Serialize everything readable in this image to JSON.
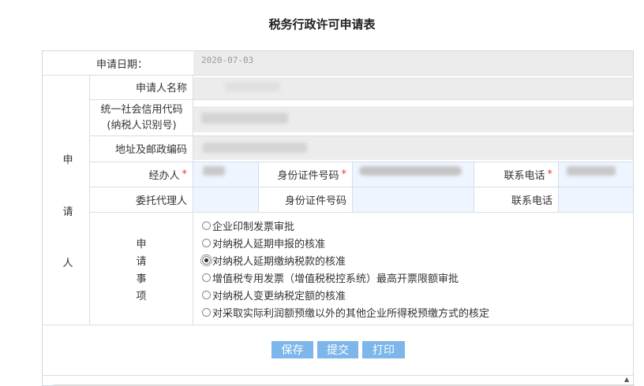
{
  "page": {
    "title": "税务行政许可申请表"
  },
  "form": {
    "apply_date_label": "申请日期：",
    "apply_date_value": "2020-07-03",
    "side_label": [
      "申",
      "请",
      "人"
    ],
    "applicant_name_label": "申请人名称",
    "credit_code_label_line1": "统一社会信用代码",
    "credit_code_label_line2": "(纳税人识别号)",
    "address_label": "地址及邮政编码",
    "handler_label": "经办人",
    "id_number_label": "身份证件号码",
    "phone_label": "联系电话",
    "agent_label": "委托代理人",
    "agent_id_label": "身份证件号码",
    "agent_phone_label": "联系电话",
    "required_mark": "*",
    "matter_label": [
      "申",
      "请",
      "事",
      "项"
    ],
    "options": [
      {
        "label": "企业印制发票审批",
        "selected": false
      },
      {
        "label": "对纳税人延期申报的核准",
        "selected": false
      },
      {
        "label": "对纳税人延期缴纳税款的核准",
        "selected": true
      },
      {
        "label": "增值税专用发票（增值税税控系统）最高开票限额审批",
        "selected": false
      },
      {
        "label": "对纳税人变更纳税定额的核准",
        "selected": false
      },
      {
        "label": "对采取实际利润额预缴以外的其他企业所得税预缴方式的核定",
        "selected": false
      }
    ]
  },
  "buttons": {
    "save": "保存",
    "submit": "提交",
    "print": "打印"
  },
  "colors": {
    "button": "#7cb6ea",
    "readonly_bg": "#ececec",
    "input_bg": "#eef5fe",
    "required": "#e53935"
  }
}
